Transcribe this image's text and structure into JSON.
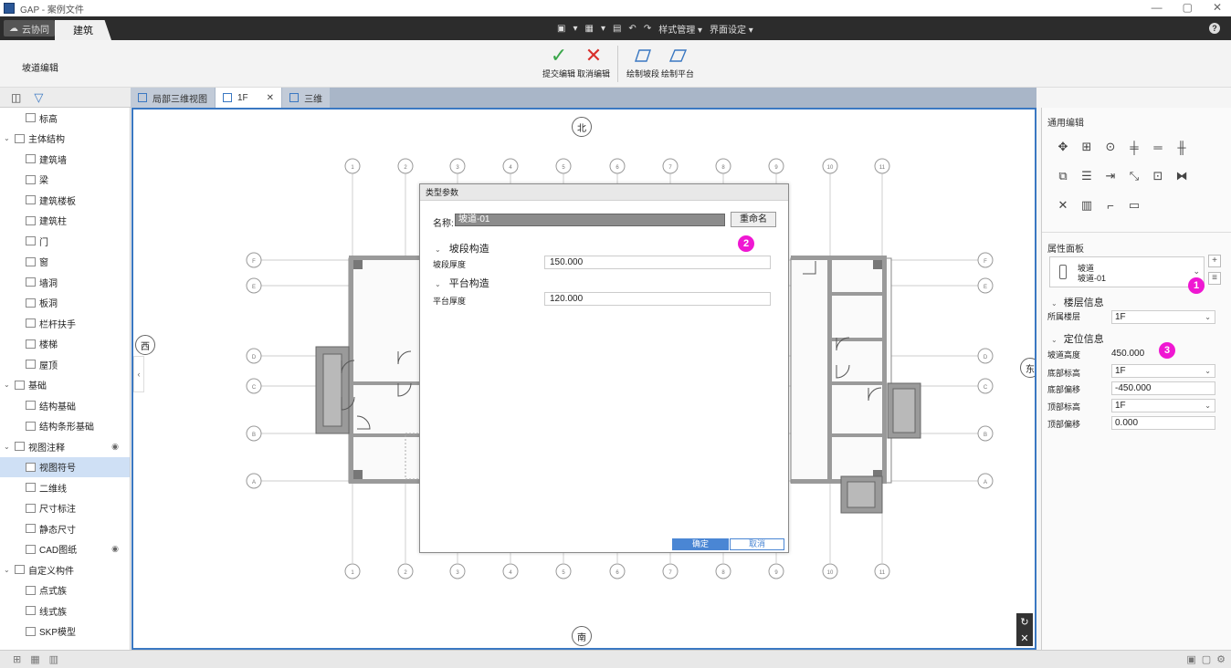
{
  "window": {
    "title": "GAP - 案例文件",
    "minimize": "—",
    "restore": "▢",
    "close": "✕"
  },
  "menubar": {
    "cloud_tab": "云协同",
    "active_tab": "建筑",
    "quick": [
      "▾",
      "▾",
      "↶",
      "↷",
      "样式管理 ▾",
      "界面设定 ▾"
    ],
    "help": "?"
  },
  "ribbon": {
    "mode_title": "坡道编辑",
    "buttons": [
      {
        "label": "提交编辑",
        "icon": "check-icon"
      },
      {
        "label": "取消编辑",
        "icon": "cross-icon"
      },
      {
        "label": "绘制坡段",
        "icon": "ramp-segment-icon"
      },
      {
        "label": "绘制平台",
        "icon": "platform-icon"
      }
    ]
  },
  "tree": {
    "items": [
      {
        "label": "标高",
        "level": 1
      },
      {
        "label": "主体结构",
        "level": 0,
        "expanded": true
      },
      {
        "label": "建筑墙",
        "level": 1
      },
      {
        "label": "梁",
        "level": 1
      },
      {
        "label": "建筑楼板",
        "level": 1
      },
      {
        "label": "建筑柱",
        "level": 1
      },
      {
        "label": "门",
        "level": 1
      },
      {
        "label": "窗",
        "level": 1
      },
      {
        "label": "墙洞",
        "level": 1
      },
      {
        "label": "板洞",
        "level": 1
      },
      {
        "label": "栏杆扶手",
        "level": 1
      },
      {
        "label": "楼梯",
        "level": 1
      },
      {
        "label": "屋顶",
        "level": 1
      },
      {
        "label": "基础",
        "level": 0,
        "expanded": true
      },
      {
        "label": "结构基础",
        "level": 1
      },
      {
        "label": "结构条形基础",
        "level": 1
      },
      {
        "label": "视图注释",
        "level": 0,
        "expanded": true,
        "eye": true
      },
      {
        "label": "视图符号",
        "level": 1,
        "selected": true
      },
      {
        "label": "二维线",
        "level": 1
      },
      {
        "label": "尺寸标注",
        "level": 1
      },
      {
        "label": "静态尺寸",
        "level": 1
      },
      {
        "label": "CAD图纸",
        "level": 1,
        "eye": true
      },
      {
        "label": "自定义构件",
        "level": 0,
        "expanded": true
      },
      {
        "label": "点式族",
        "level": 1
      },
      {
        "label": "线式族",
        "level": 1
      },
      {
        "label": "SKP模型",
        "level": 1
      }
    ]
  },
  "doc_tabs": [
    {
      "label": "局部三维视图",
      "active": false
    },
    {
      "label": "1F",
      "active": true,
      "close": "✕"
    },
    {
      "label": "三维",
      "active": false
    }
  ],
  "canvas": {
    "north": "北",
    "south": "南",
    "east": "东",
    "west": "西",
    "top_axes": [
      "1",
      "2",
      "3",
      "4",
      "5",
      "6",
      "7",
      "8",
      "9",
      "10",
      "11"
    ],
    "bottom_axes": [
      "1",
      "2",
      "3",
      "4",
      "5",
      "6",
      "7",
      "8",
      "9",
      "10",
      "11"
    ],
    "side_axes": [
      "F",
      "E",
      "D",
      "C",
      "B",
      "A"
    ],
    "collapse": "‹"
  },
  "dialog": {
    "title": "类型参数",
    "name_label": "名称:",
    "name_value": "坡道-01",
    "rename": "重命名",
    "section1": "坡段构造",
    "row1_label": "坡段厚度",
    "row1_value": "150.000",
    "section2": "平台构造",
    "row2_label": "平台厚度",
    "row2_value": "120.000",
    "ok": "确定",
    "cancel": "取消"
  },
  "badges": [
    "1",
    "2",
    "3"
  ],
  "right_panel": {
    "edit_title": "通用编辑",
    "props_title": "属性面板",
    "type_line1": "坡道",
    "type_line2": "坡道-01",
    "add_btn": "+",
    "menu_btn": "≡",
    "section_floor": "楼层信息",
    "floor_label": "所属楼层",
    "floor_value": "1F",
    "section_pos": "定位信息",
    "ramp_height_label": "坡道高度",
    "ramp_height_value": "450.000",
    "bottom_level_label": "底部标高",
    "bottom_level_value": "1F",
    "bottom_offset_label": "底部偏移",
    "bottom_offset_value": "-450.000",
    "top_level_label": "顶部标高",
    "top_level_value": "1F",
    "top_offset_label": "顶部偏移",
    "top_offset_value": "0.000"
  },
  "colors": {
    "accent": "#3a78c2",
    "badge": "#ef17d2",
    "ok": "#4a86d4"
  }
}
